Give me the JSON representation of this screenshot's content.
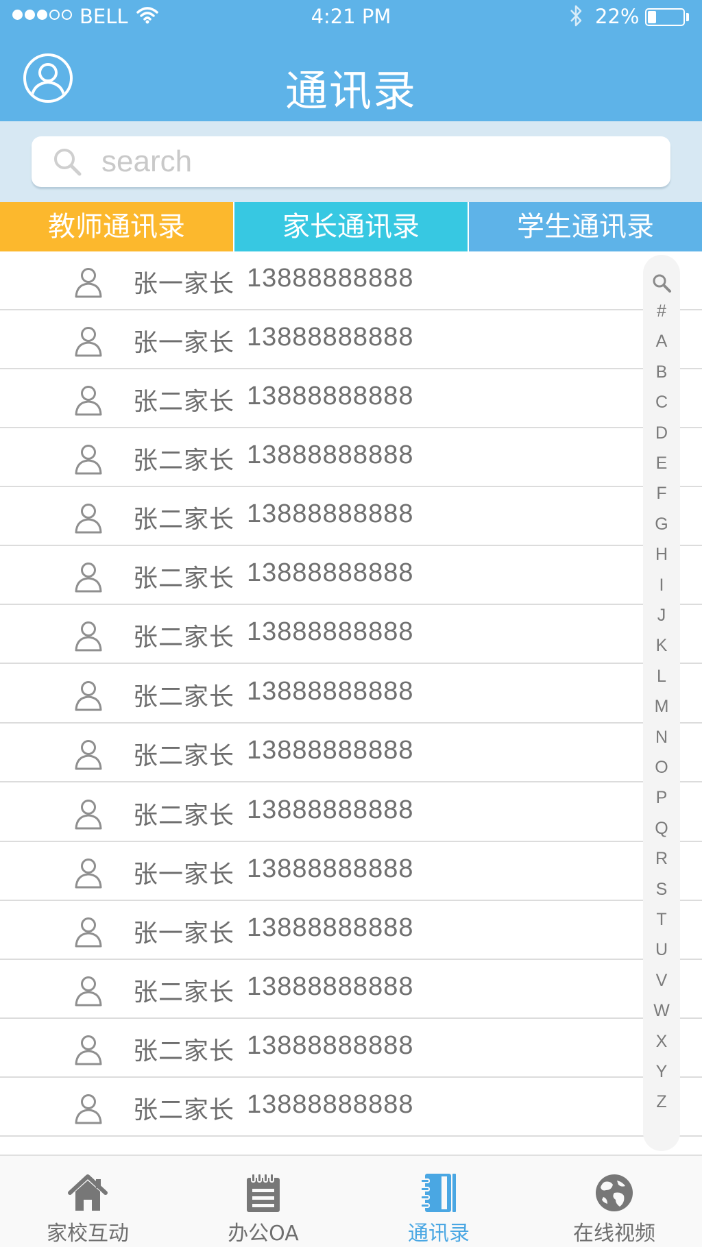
{
  "status_bar": {
    "carrier": "BELL",
    "time": "4:21 PM",
    "battery": "22%",
    "battery_level": 0.22
  },
  "header": {
    "title": "通讯录"
  },
  "search": {
    "placeholder": "search"
  },
  "tabs": [
    {
      "label": "教师通讯录",
      "color": "#fcb82d"
    },
    {
      "label": "家长通讯录",
      "color": "#37c8e2"
    },
    {
      "label": "学生通讯录",
      "color": "#5eb3e8"
    }
  ],
  "contacts": [
    {
      "name": "张一家长",
      "phone": "13888888888"
    },
    {
      "name": "张一家长",
      "phone": "13888888888"
    },
    {
      "name": "张二家长",
      "phone": "13888888888"
    },
    {
      "name": "张二家长",
      "phone": "13888888888"
    },
    {
      "name": "张二家长",
      "phone": "13888888888"
    },
    {
      "name": "张二家长",
      "phone": "13888888888"
    },
    {
      "name": "张二家长",
      "phone": "13888888888"
    },
    {
      "name": "张二家长",
      "phone": "13888888888"
    },
    {
      "name": "张二家长",
      "phone": "13888888888"
    },
    {
      "name": "张二家长",
      "phone": "13888888888"
    },
    {
      "name": "张一家长",
      "phone": "13888888888"
    },
    {
      "name": "张一家长",
      "phone": "13888888888"
    },
    {
      "name": "张二家长",
      "phone": "13888888888"
    },
    {
      "name": "张二家长",
      "phone": "13888888888"
    },
    {
      "name": "张二家长",
      "phone": "13888888888"
    }
  ],
  "index_letters": [
    "#",
    "A",
    "B",
    "C",
    "D",
    "E",
    "F",
    "G",
    "H",
    "I",
    "J",
    "K",
    "L",
    "M",
    "N",
    "O",
    "P",
    "Q",
    "R",
    "S",
    "T",
    "U",
    "V",
    "W",
    "X",
    "Y",
    "Z"
  ],
  "tabbar": [
    {
      "label": "家校互动",
      "icon": "home-icon",
      "active": false
    },
    {
      "label": "办公OA",
      "icon": "notepad-icon",
      "active": false
    },
    {
      "label": "通讯录",
      "icon": "address-book-icon",
      "active": true
    },
    {
      "label": "在线视频",
      "icon": "globe-icon",
      "active": false
    }
  ],
  "colors": {
    "header_blue": "#5eb3e8",
    "search_bg": "#d7e8f3",
    "teacher_tab": "#fcb82d",
    "parent_tab": "#37c8e2",
    "student_tab": "#5eb3e8",
    "active_tab_text": "#4aa7e3",
    "inactive_icon": "#777777"
  }
}
